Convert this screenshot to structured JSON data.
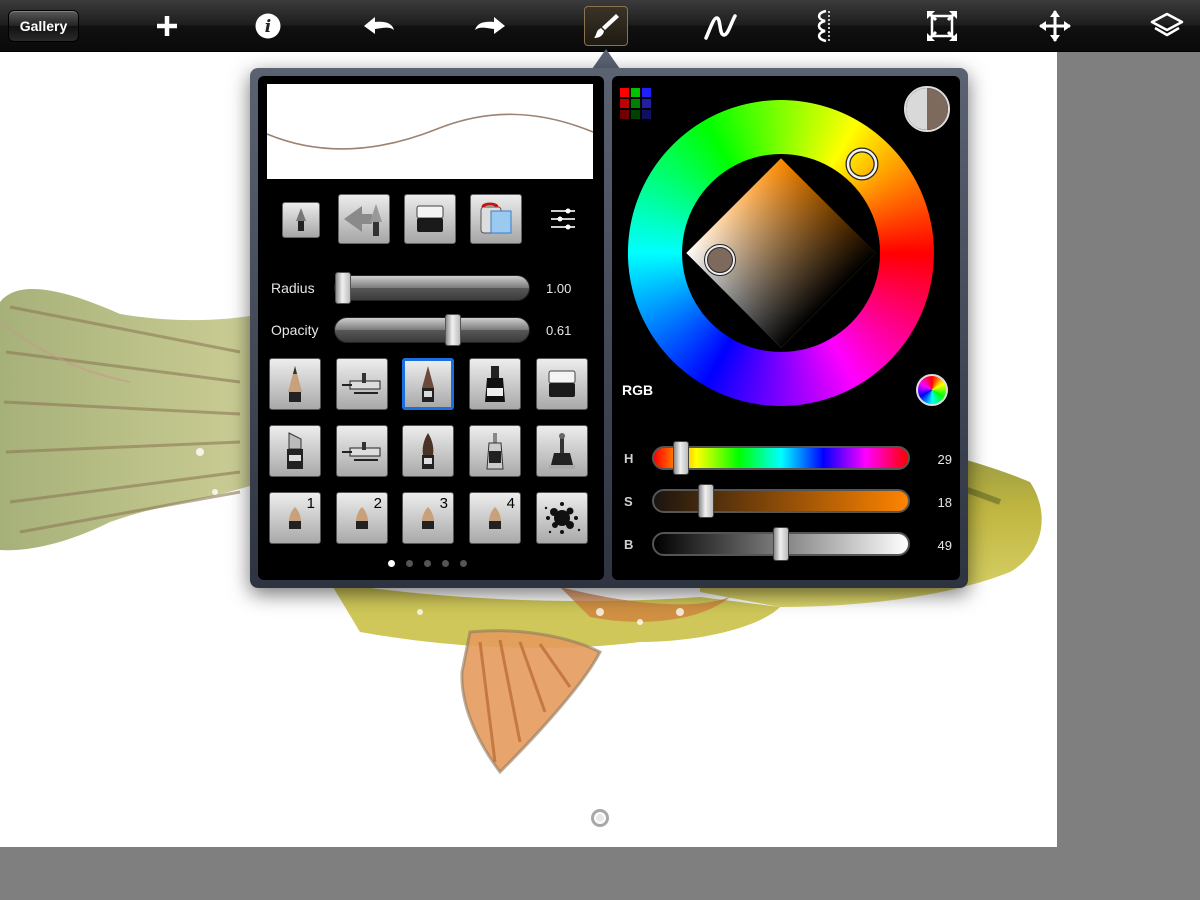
{
  "toolbar": {
    "gallery_label": "Gallery",
    "tools": [
      {
        "name": "add-icon"
      },
      {
        "name": "info-icon"
      },
      {
        "name": "undo-icon"
      },
      {
        "name": "redo-icon"
      },
      {
        "name": "brush-icon",
        "active": true
      },
      {
        "name": "stroke-icon"
      },
      {
        "name": "symmetry-icon"
      },
      {
        "name": "transform-icon"
      },
      {
        "name": "move-icon"
      },
      {
        "name": "layers-icon"
      }
    ]
  },
  "brush_panel": {
    "stroke_preview_color": "#9b8272",
    "radius": {
      "label": "Radius",
      "value": "1.00",
      "fraction": 0.0
    },
    "opacity": {
      "label": "Opacity",
      "value": "0.61",
      "fraction": 0.61
    },
    "numbered_brushes": [
      "1",
      "2",
      "3",
      "4"
    ],
    "pages": 5,
    "active_page": 0,
    "selected_brush_index": 2
  },
  "color_panel": {
    "mode_label": "RGB",
    "current_color": "#7d6a5d",
    "previous_color": "#d9d9d9",
    "swatches": [
      "#ff0000",
      "#00c000",
      "#2020ff",
      "#c00000",
      "#008000",
      "#2020a0",
      "#700000",
      "#004000",
      "#101060"
    ],
    "hue": {
      "label": "H",
      "value": "29",
      "fraction": 0.08
    },
    "saturation": {
      "label": "S",
      "value": "18",
      "fraction": 0.18
    },
    "brightness": {
      "label": "B",
      "value": "49",
      "fraction": 0.49
    }
  }
}
